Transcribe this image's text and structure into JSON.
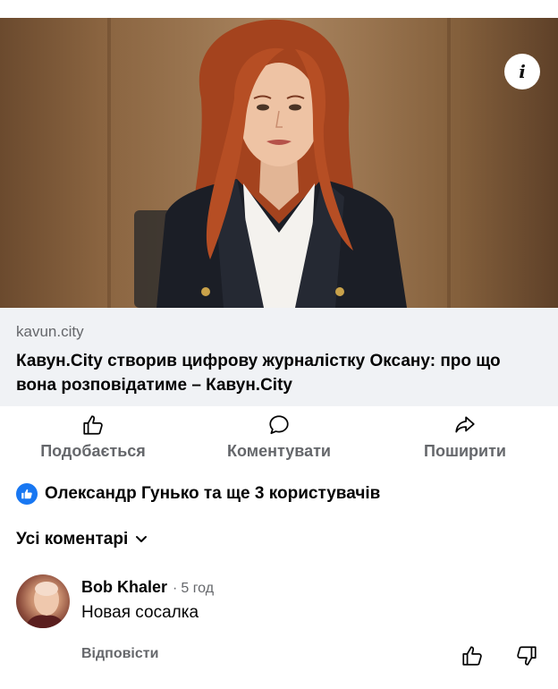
{
  "post": {
    "image": {
      "alt": "",
      "info_icon": "info-icon"
    },
    "link": {
      "domain": "kavun.city",
      "title": "Кавун.City створив цифрову журналістку Оксану: про що вона розповідатиме – Кавун.City"
    },
    "actions": {
      "like_label": "Подобається",
      "comment_label": "Коментувати",
      "share_label": "Поширити"
    },
    "reactions": {
      "icon": "like-badge-icon",
      "summary": "Олександр Гунько та ще 3 користувачів"
    },
    "comments_filter": {
      "label": "Усі коментарі"
    },
    "comments": [
      {
        "author": "Bob Khaler",
        "time": "5 год",
        "text": "Новая сосалка",
        "reply_label": "Відповісти"
      }
    ]
  },
  "colors": {
    "link_card_bg": "#f0f2f5",
    "secondary_text": "#65676b",
    "primary_text": "#050505",
    "like_blue": "#1877f2"
  }
}
